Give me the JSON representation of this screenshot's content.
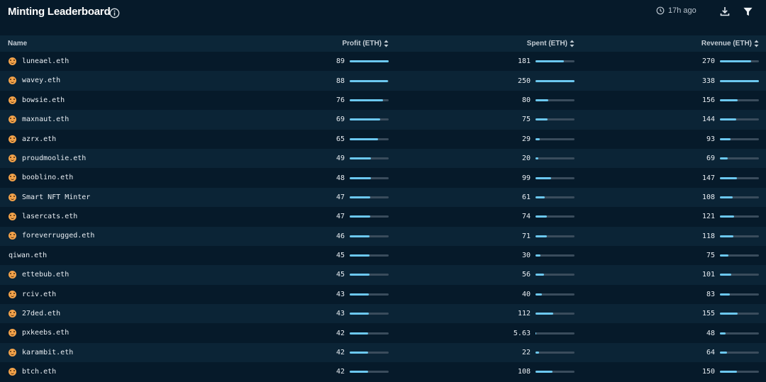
{
  "header": {
    "title": "Minting Leaderboard",
    "updated": "17h ago"
  },
  "columns": {
    "name": "Name",
    "profit": "Profit (ETH)",
    "spent": "Spent (ETH)",
    "revenue": "Revenue (ETH)"
  },
  "colors": {
    "bar_fill": "#6cc8f0",
    "bar_track": "#3a4c5c",
    "background": "#061a2a"
  },
  "rows": [
    {
      "name": "luneael.eth",
      "avatar": true,
      "profit": "89",
      "spent": "181",
      "revenue": "270"
    },
    {
      "name": "wavey.eth",
      "avatar": true,
      "profit": "88",
      "spent": "250",
      "revenue": "338"
    },
    {
      "name": "bowsie.eth",
      "avatar": true,
      "profit": "76",
      "spent": "80",
      "revenue": "156"
    },
    {
      "name": "maxnaut.eth",
      "avatar": true,
      "profit": "69",
      "spent": "75",
      "revenue": "144"
    },
    {
      "name": "azrx.eth",
      "avatar": true,
      "profit": "65",
      "spent": "29",
      "revenue": "93"
    },
    {
      "name": "proudmoolie.eth",
      "avatar": true,
      "profit": "49",
      "spent": "20",
      "revenue": "69"
    },
    {
      "name": "booblino.eth",
      "avatar": true,
      "profit": "48",
      "spent": "99",
      "revenue": "147"
    },
    {
      "name": "Smart NFT Minter",
      "avatar": true,
      "profit": "47",
      "spent": "61",
      "revenue": "108"
    },
    {
      "name": "lasercats.eth",
      "avatar": true,
      "profit": "47",
      "spent": "74",
      "revenue": "121"
    },
    {
      "name": "foreverrugged.eth",
      "avatar": true,
      "profit": "46",
      "spent": "71",
      "revenue": "118"
    },
    {
      "name": "qiwan.eth",
      "avatar": false,
      "profit": "45",
      "spent": "30",
      "revenue": "75"
    },
    {
      "name": "ettebub.eth",
      "avatar": true,
      "profit": "45",
      "spent": "56",
      "revenue": "101"
    },
    {
      "name": "rciv.eth",
      "avatar": true,
      "profit": "43",
      "spent": "40",
      "revenue": "83"
    },
    {
      "name": "27ded.eth",
      "avatar": true,
      "profit": "43",
      "spent": "112",
      "revenue": "155"
    },
    {
      "name": "pxkeebs.eth",
      "avatar": true,
      "profit": "42",
      "spent": "5.63",
      "revenue": "48"
    },
    {
      "name": "karambit.eth",
      "avatar": true,
      "profit": "42",
      "spent": "22",
      "revenue": "64"
    },
    {
      "name": "btch.eth",
      "avatar": true,
      "profit": "42",
      "spent": "108",
      "revenue": "150"
    }
  ]
}
